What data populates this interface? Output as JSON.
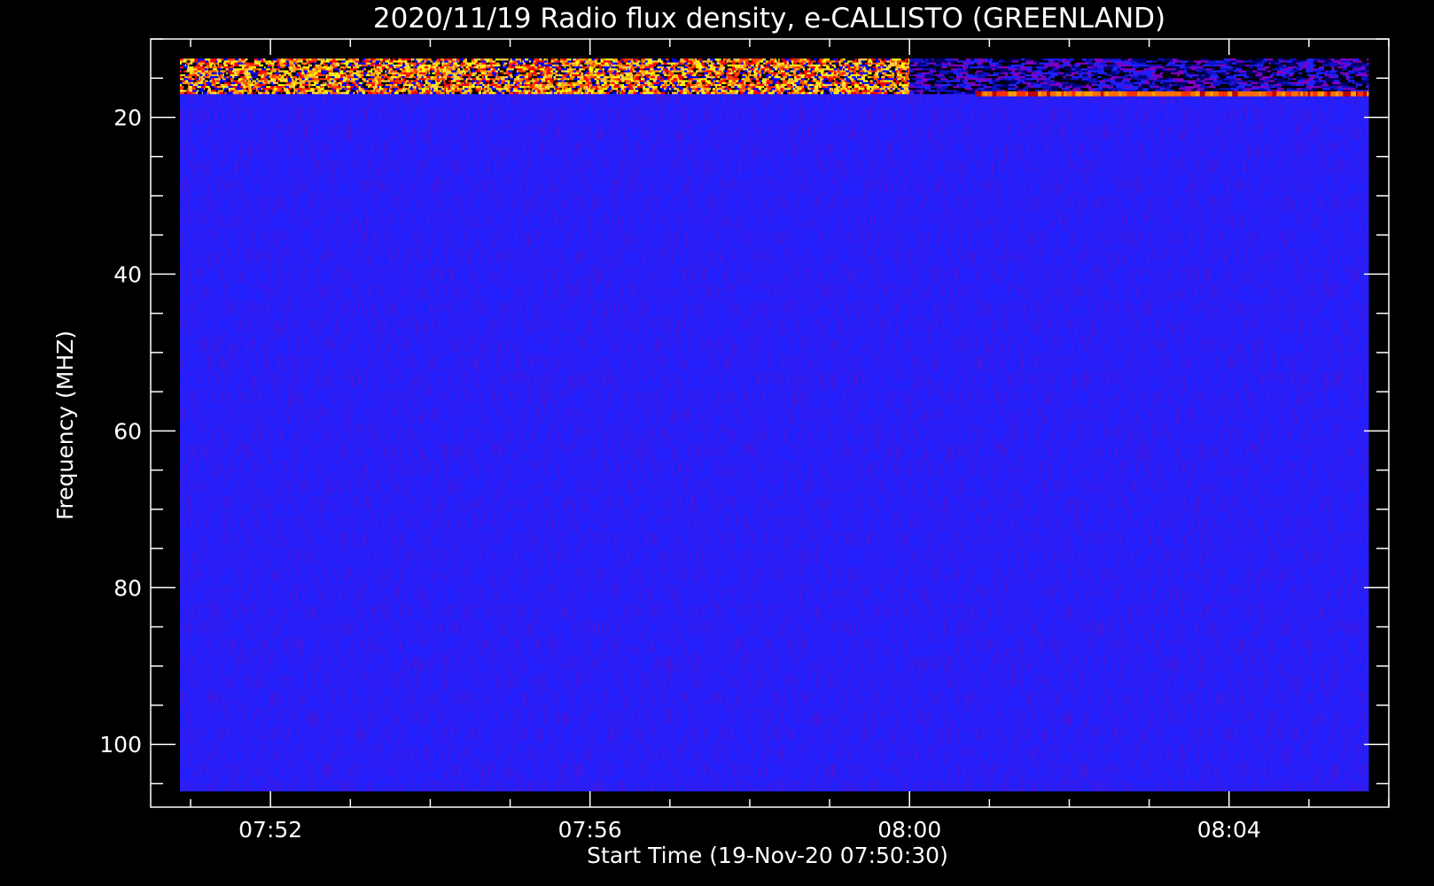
{
  "chart_data": {
    "type": "heatmap",
    "title": "2020/11/19  Radio flux density, e-CALLISTO (GREENLAND)",
    "xlabel": "Start Time (19-Nov-20 07:50:30)",
    "ylabel": "Frequency (MHZ)",
    "x_axis": {
      "unit": "time (UT)",
      "range": [
        "07:50:30",
        "08:06:00"
      ],
      "data_range": [
        "07:50:52",
        "08:05:45"
      ],
      "major_ticks": [
        "07:52",
        "07:56",
        "08:00",
        "08:04"
      ],
      "minor_tick_interval_minutes": 1
    },
    "y_axis": {
      "unit": "MHz",
      "range": [
        10,
        108
      ],
      "inverted": true,
      "data_range": [
        12.5,
        106
      ],
      "major_ticks": [
        20,
        40,
        60,
        80,
        100
      ],
      "minor_tick_interval": 5
    },
    "colormap": [
      "#000000",
      "#0000ff",
      "#ff0000",
      "#ffa500",
      "#ffff00"
    ],
    "background_color": "#2020ff",
    "features": [
      {
        "description": "Bright interference band",
        "time_range": [
          "07:50:52",
          "08:00:00"
        ],
        "frequency_range": [
          12.5,
          17
        ]
      },
      {
        "description": "Narrow emission line",
        "time_range": [
          "08:00:50",
          "08:05:45"
        ],
        "frequency_range": [
          16.8,
          17.2
        ]
      }
    ],
    "grid": false,
    "legend": "none"
  }
}
